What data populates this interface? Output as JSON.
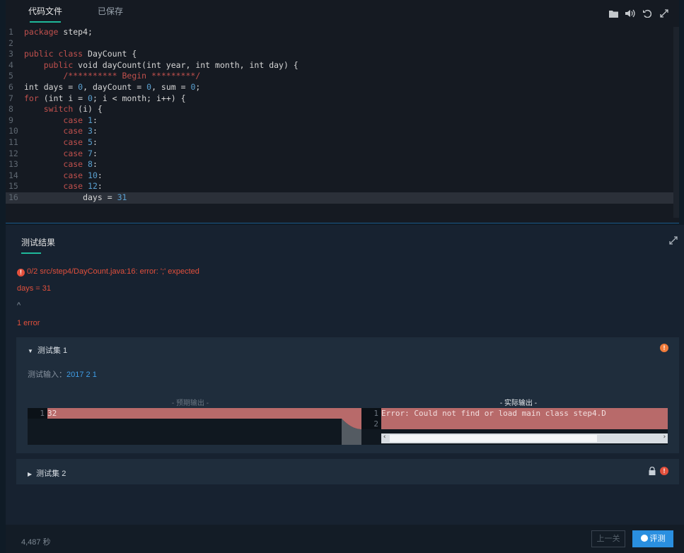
{
  "editor": {
    "tabs": [
      {
        "label": "代码文件",
        "active": true
      },
      {
        "label": "已保存",
        "active": false
      }
    ],
    "toolbar_icons": [
      "folder-icon",
      "sound-icon",
      "undo-icon",
      "fullscreen-icon"
    ],
    "lines": [
      {
        "n": "1",
        "parts": [
          [
            "kw",
            "package"
          ],
          [
            "txt",
            " step4;"
          ]
        ]
      },
      {
        "n": "2",
        "parts": []
      },
      {
        "n": "3",
        "parts": [
          [
            "kw",
            "public"
          ],
          [
            "txt",
            " "
          ],
          [
            "kw",
            "class"
          ],
          [
            "txt",
            " DayCount {"
          ]
        ]
      },
      {
        "n": "4",
        "parts": [
          [
            "txt",
            "    "
          ],
          [
            "kw",
            "public"
          ],
          [
            "txt",
            " void dayCount(int year, int month, int day) {"
          ]
        ]
      },
      {
        "n": "5",
        "parts": [
          [
            "cm",
            "        /********** Begin *********/"
          ]
        ]
      },
      {
        "n": "6",
        "parts": [
          [
            "txt",
            "int days = "
          ],
          [
            "num",
            "0"
          ],
          [
            "txt",
            ", dayCount = "
          ],
          [
            "num",
            "0"
          ],
          [
            "txt",
            ", sum = "
          ],
          [
            "num",
            "0"
          ],
          [
            "txt",
            ";"
          ]
        ]
      },
      {
        "n": "7",
        "parts": [
          [
            "kw",
            "for"
          ],
          [
            "txt",
            " (int i = "
          ],
          [
            "num",
            "0"
          ],
          [
            "txt",
            "; i < month; i++) {"
          ]
        ]
      },
      {
        "n": "8",
        "parts": [
          [
            "txt",
            "    "
          ],
          [
            "kw",
            "switch"
          ],
          [
            "txt",
            " (i) {"
          ]
        ]
      },
      {
        "n": "9",
        "parts": [
          [
            "txt",
            "        "
          ],
          [
            "kw",
            "case"
          ],
          [
            "txt",
            " "
          ],
          [
            "num",
            "1"
          ],
          [
            "txt",
            ":"
          ]
        ]
      },
      {
        "n": "10",
        "parts": [
          [
            "txt",
            "        "
          ],
          [
            "kw",
            "case"
          ],
          [
            "txt",
            " "
          ],
          [
            "num",
            "3"
          ],
          [
            "txt",
            ":"
          ]
        ]
      },
      {
        "n": "11",
        "parts": [
          [
            "txt",
            "        "
          ],
          [
            "kw",
            "case"
          ],
          [
            "txt",
            " "
          ],
          [
            "num",
            "5"
          ],
          [
            "txt",
            ":"
          ]
        ]
      },
      {
        "n": "12",
        "parts": [
          [
            "txt",
            "        "
          ],
          [
            "kw",
            "case"
          ],
          [
            "txt",
            " "
          ],
          [
            "num",
            "7"
          ],
          [
            "txt",
            ":"
          ]
        ]
      },
      {
        "n": "13",
        "parts": [
          [
            "txt",
            "        "
          ],
          [
            "kw",
            "case"
          ],
          [
            "txt",
            " "
          ],
          [
            "num",
            "8"
          ],
          [
            "txt",
            ":"
          ]
        ]
      },
      {
        "n": "14",
        "parts": [
          [
            "txt",
            "        "
          ],
          [
            "kw",
            "case"
          ],
          [
            "txt",
            " "
          ],
          [
            "num",
            "10"
          ],
          [
            "txt",
            ":"
          ]
        ]
      },
      {
        "n": "15",
        "parts": [
          [
            "txt",
            "        "
          ],
          [
            "kw",
            "case"
          ],
          [
            "txt",
            " "
          ],
          [
            "num",
            "12"
          ],
          [
            "txt",
            ":"
          ]
        ]
      },
      {
        "n": "16",
        "parts": [
          [
            "txt",
            "            days = "
          ],
          [
            "num",
            "31"
          ]
        ]
      }
    ]
  },
  "result": {
    "title": "测试结果",
    "error_summary": "0/2 src/step4/DayCount.java:16: error: ';' expected",
    "error_code": "days = 31",
    "caret": "^",
    "error_count": "1 error",
    "testset1": {
      "title": "测试集 1",
      "input_label": "测试输入：",
      "input_value": "2017 2 1",
      "expected_label": "- 预期输出 -",
      "actual_label": "- 实际输出 -",
      "expected_lines": [
        {
          "n": "1",
          "v": "32"
        }
      ],
      "actual_lines": [
        {
          "n": "1",
          "v": "Error: Could not find or load main class step4.D"
        },
        {
          "n": "2",
          "v": ""
        }
      ]
    },
    "testset2": {
      "title": "测试集 2"
    }
  },
  "footer": {
    "timer": "4,487 秒",
    "prev_label": "上一关",
    "eval_label": "评测"
  }
}
